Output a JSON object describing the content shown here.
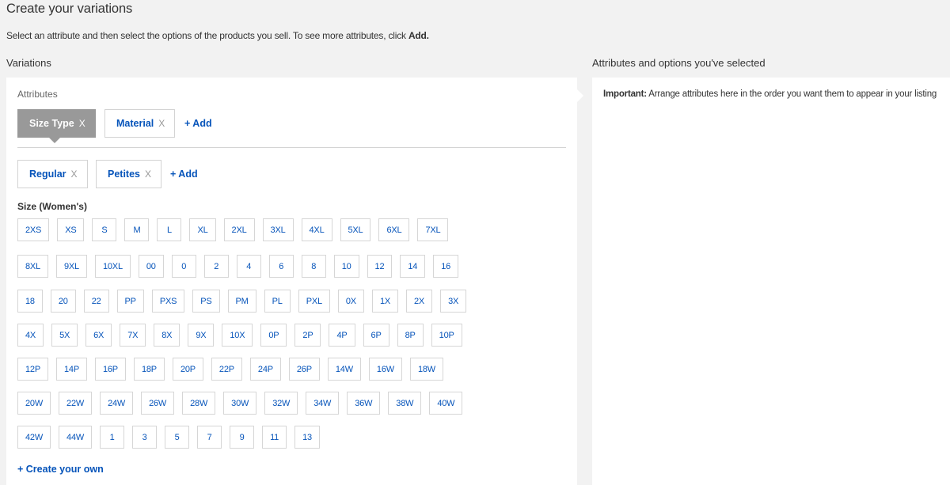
{
  "page": {
    "title": "Create your variations",
    "description": "Select an attribute and then select the options of the products you sell. To see more attributes, click",
    "description_bold": "Add."
  },
  "variations": {
    "heading": "Variations",
    "attributes_label": "Attributes",
    "attributes": [
      {
        "label": "Size Type",
        "remove": "X",
        "active": true
      },
      {
        "label": "Material",
        "remove": "X",
        "active": false
      }
    ],
    "add_attribute_label": "+ Add",
    "attribute_values": [
      {
        "label": "Regular",
        "remove": "X"
      },
      {
        "label": "Petites",
        "remove": "X"
      }
    ],
    "add_value_label": "+ Add",
    "size_label": "Size (Women's)",
    "size_rows": [
      [
        "2XS",
        "XS",
        "S",
        "M",
        "L",
        "XL",
        "2XL",
        "3XL",
        "4XL",
        "5XL",
        "6XL",
        "7XL"
      ],
      [
        "8XL",
        "9XL",
        "10XL",
        "00",
        "0",
        "2",
        "4",
        "6",
        "8",
        "10",
        "12",
        "14",
        "16"
      ],
      [
        "18",
        "20",
        "22",
        "PP",
        "PXS",
        "PS",
        "PM",
        "PL",
        "PXL",
        "0X",
        "1X",
        "2X",
        "3X"
      ],
      [
        "4X",
        "5X",
        "6X",
        "7X",
        "8X",
        "9X",
        "10X",
        "0P",
        "2P",
        "4P",
        "6P",
        "8P",
        "10P"
      ],
      [
        "12P",
        "14P",
        "16P",
        "18P",
        "20P",
        "22P",
        "24P",
        "26P",
        "14W",
        "16W",
        "18W"
      ],
      [
        "20W",
        "22W",
        "24W",
        "26W",
        "28W",
        "30W",
        "32W",
        "34W",
        "36W",
        "38W",
        "40W"
      ],
      [
        "42W",
        "44W",
        "1",
        "3",
        "5",
        "7",
        "9",
        "11",
        "13"
      ]
    ],
    "create_own_label": "+ Create your own"
  },
  "selected": {
    "heading": "Attributes and options you've selected",
    "important_bold": "Important:",
    "important_text": "Arrange attributes here in the order you want them to appear in your listing"
  },
  "colors": {
    "link": "#0654ba",
    "active_chip": "#999999"
  }
}
